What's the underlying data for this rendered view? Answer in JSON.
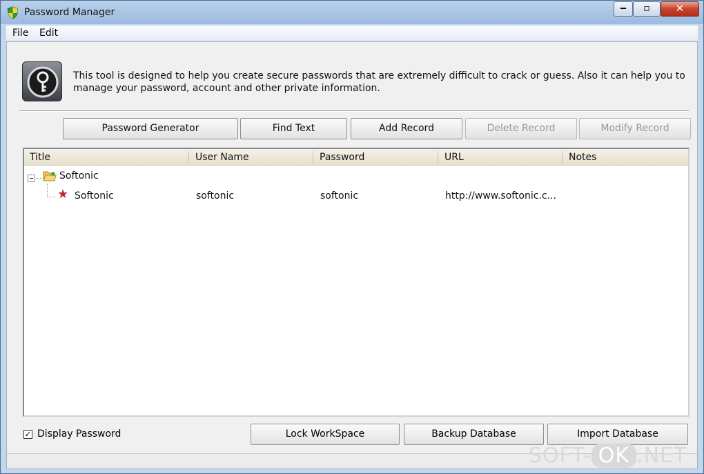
{
  "window": {
    "title": "Password Manager"
  },
  "menu": [
    "File",
    "Edit"
  ],
  "intro_text": "This tool is designed to help you create secure passwords that are extremely difficult to crack or guess. Also it can help you to manage your password, account and other private information.",
  "toolbar": {
    "password_generator": "Password Generator",
    "find_text": "Find Text",
    "add_record": "Add Record",
    "delete_record": "Delete Record",
    "modify_record": "Modify Record"
  },
  "columns": [
    "Title",
    "User Name",
    "Password",
    "URL",
    "Notes"
  ],
  "tree": {
    "group": "Softonic",
    "record": {
      "title": "Softonic",
      "username": "softonic",
      "password": "softonic",
      "url": "http://www.softonic.c...",
      "notes": ""
    }
  },
  "footer": {
    "display_password_label": "Display Password",
    "display_password_checked": true,
    "check_mark": "✓",
    "lock_workspace": "Lock WorkSpace",
    "backup_database": "Backup Database",
    "import_database": "Import Database"
  },
  "watermark": {
    "left": "SOFT-",
    "ok": "OK",
    "right": ".NET"
  },
  "icons": {
    "app": "shield-icon",
    "logo": "key-logo-icon",
    "folder": "folder-icon",
    "record": "star-icon"
  },
  "colors": {
    "close_button": "#c8432b",
    "star": "#c0272d",
    "header_bg": "#e6e0cd"
  }
}
